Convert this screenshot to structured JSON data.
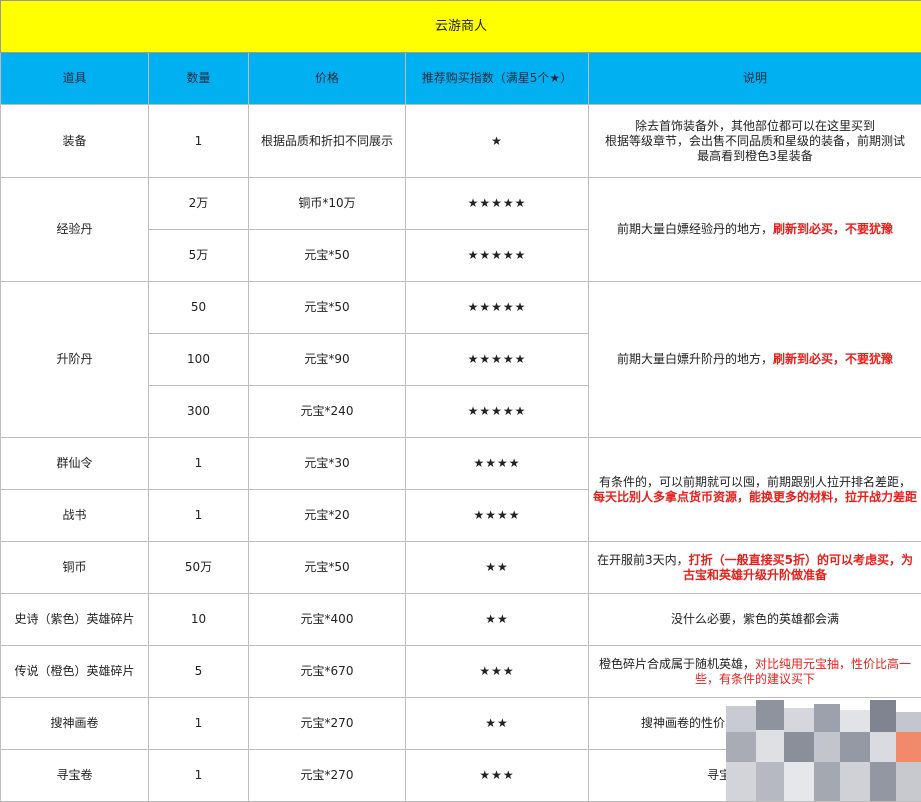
{
  "title": "云游商人",
  "headers": [
    "道具",
    "数量",
    "价格",
    "推荐购买指数（满星5个★）",
    "说明"
  ],
  "rows": {
    "equip": {
      "item": "装备",
      "qty": "1",
      "price": "根据品质和折扣不同展示",
      "stars": "★",
      "note_lines": [
        "除去首饰装备外，其他部位都可以在这里买到",
        "根据等级章节，会出售不同品质和星级的装备，前期测试",
        "最高看到橙色3星装备"
      ]
    },
    "exp": {
      "item": "经验丹",
      "sub": [
        {
          "qty": "2万",
          "price": "铜币*10万",
          "stars": "★★★★★"
        },
        {
          "qty": "5万",
          "price": "元宝*50",
          "stars": "★★★★★"
        }
      ],
      "note_plain": "前期大量白嫖经验丹的地方，",
      "note_red": "刷新到必买，不要犹豫"
    },
    "stage": {
      "item": "升阶丹",
      "sub": [
        {
          "qty": "50",
          "price": "元宝*50",
          "stars": "★★★★★"
        },
        {
          "qty": "100",
          "price": "元宝*90",
          "stars": "★★★★★"
        },
        {
          "qty": "300",
          "price": "元宝*240",
          "stars": "★★★★★"
        }
      ],
      "note_plain": "前期大量白嫖升阶丹的地方，",
      "note_red": "刷新到必买，不要犹豫"
    },
    "qunxian": {
      "item": "群仙令",
      "qty": "1",
      "price": "元宝*30",
      "stars": "★★★★"
    },
    "zhanshu": {
      "item": "战书",
      "qty": "1",
      "price": "元宝*20",
      "stars": "★★★★"
    },
    "shared_note": {
      "plain": "有条件的，可以前期就可以囤，前期跟别人拉开排名差距，",
      "red": "每天比别人多拿点货币资源，能换更多的材料，拉开战力差距"
    },
    "coin": {
      "item": "铜币",
      "qty": "50万",
      "price": "元宝*50",
      "stars": "★★",
      "note_plain": "在开服前3天内，",
      "note_red": "打折（一般直接买5折）的可以考虑买，为古宝和英雄升级升阶做准备"
    },
    "epic": {
      "item": "史诗（紫色）英雄碎片",
      "qty": "10",
      "price": "元宝*400",
      "stars": "★★",
      "note": "没什么必要，紫色的英雄都会满"
    },
    "legend": {
      "item": "传说（橙色）英雄碎片",
      "qty": "5",
      "price": "元宝*670",
      "stars": "★★★",
      "note_plain": "橙色碎片合成属于随机英雄，",
      "note_red": "对比纯用元宝抽，性价比高一些，有条件的建议买下"
    },
    "scroll": {
      "item": "搜神画卷",
      "qty": "1",
      "price": "元宝*270",
      "stars": "★★",
      "note": "搜神画卷的性价比不高，一般的同学都不买"
    },
    "treasure": {
      "item": "寻宝卷",
      "qty": "1",
      "price": "元宝*270",
      "stars": "★★★",
      "note": "寻宝卷前期的产出"
    }
  },
  "colors": {
    "title_bg": "#ffff00",
    "header_bg": "#00b0f0",
    "highlight": "#e8201c"
  }
}
